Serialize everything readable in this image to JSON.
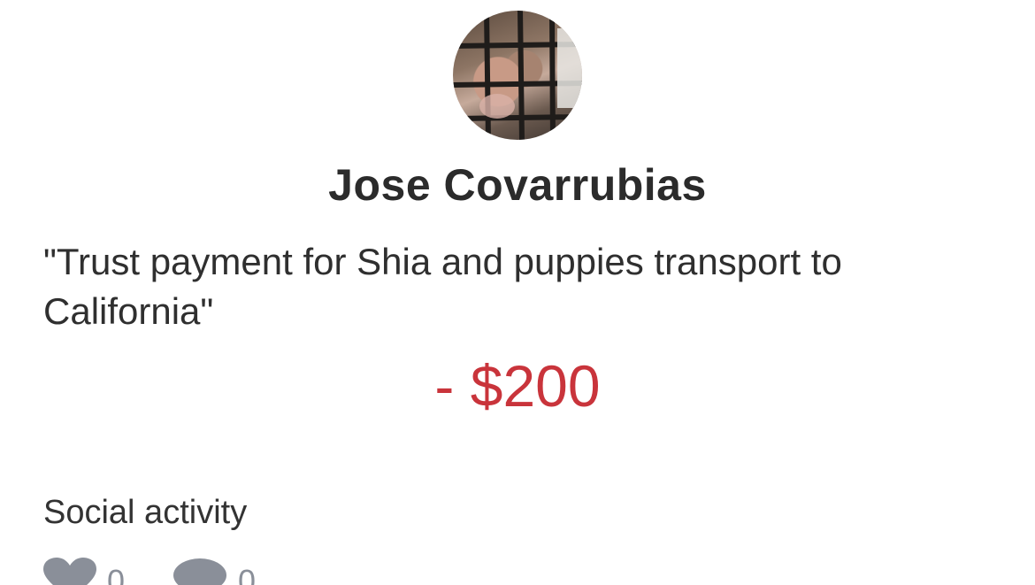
{
  "transaction": {
    "name": "Jose Covarrubias",
    "note": "\"Trust payment for Shia and puppies transport to California\"",
    "amount": "- $200",
    "amount_color": "#c9343b"
  },
  "social": {
    "title": "Social activity",
    "likes": "0",
    "comments": "0",
    "like_icon": "heart-icon",
    "comment_icon": "comment-icon",
    "icon_color": "#8a8f99"
  }
}
